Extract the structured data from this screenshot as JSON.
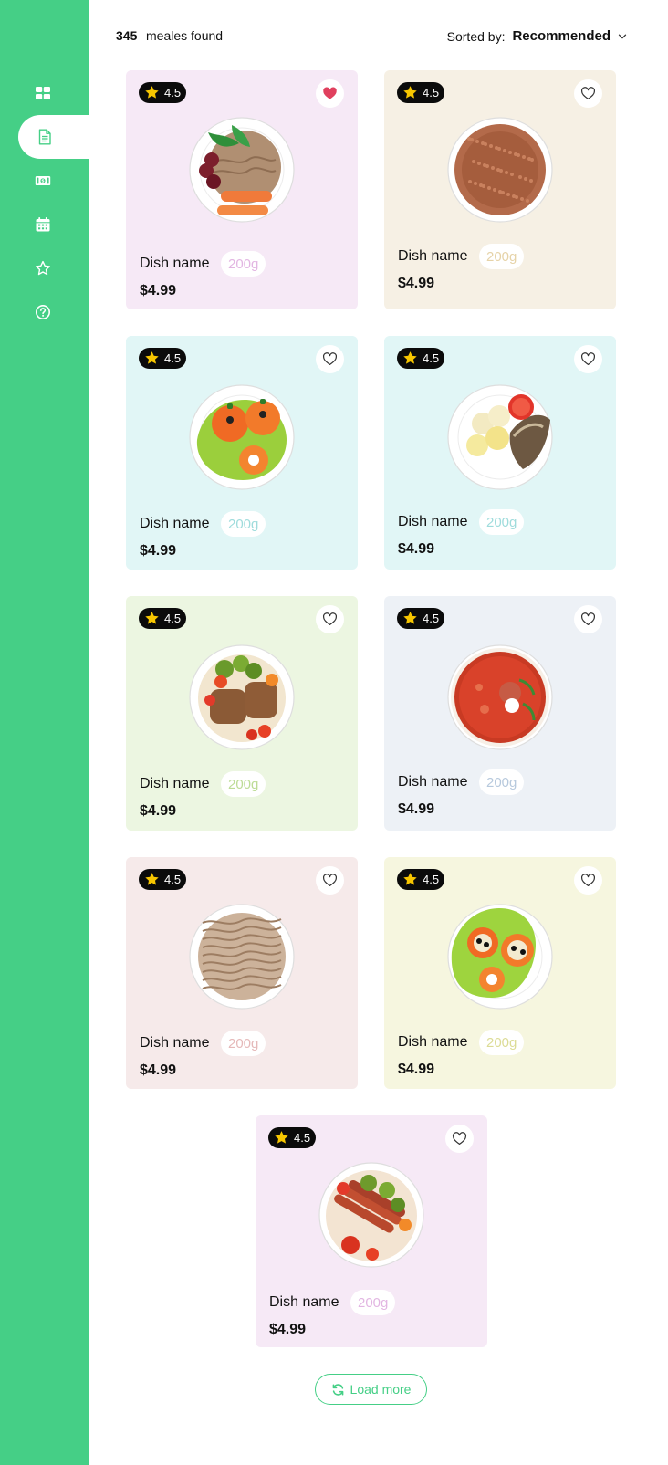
{
  "sidebar": {
    "items": [
      {
        "icon": "grid-icon",
        "active": false
      },
      {
        "icon": "document-icon",
        "active": true
      },
      {
        "icon": "money-icon",
        "active": false
      },
      {
        "icon": "calendar-icon",
        "active": false
      },
      {
        "icon": "star-icon",
        "active": false
      },
      {
        "icon": "help-icon",
        "active": false
      }
    ],
    "background": "#45cf86"
  },
  "results": {
    "count": "345",
    "count_label": "meales found",
    "sort_label": "Sorted by:",
    "sort_value": "Recommended"
  },
  "dishes": [
    {
      "rating": "4.5",
      "name": "Dish name",
      "weight": "200g",
      "price": "$4.99",
      "favorite": true,
      "bg": "#f6e9f6",
      "weight_color": "#e2b6e2",
      "plate": "noodles-carrots"
    },
    {
      "rating": "4.5",
      "name": "Dish name",
      "weight": "200g",
      "price": "$4.99",
      "favorite": false,
      "bg": "#f6f0e4",
      "weight_color": "#e6d3a8",
      "plate": "buckwheat"
    },
    {
      "rating": "4.5",
      "name": "Dish name",
      "weight": "200g",
      "price": "$4.99",
      "favorite": false,
      "bg": "#e1f6f6",
      "weight_color": "#9fdcdc",
      "plate": "stuffed-tomatoes"
    },
    {
      "rating": "4.5",
      "name": "Dish name",
      "weight": "200g",
      "price": "$4.99",
      "favorite": false,
      "bg": "#e1f6f6",
      "weight_color": "#9fdcdc",
      "plate": "fish-potatoes"
    },
    {
      "rating": "4.5",
      "name": "Dish name",
      "weight": "200g",
      "price": "$4.99",
      "favorite": false,
      "bg": "#ecf6e1",
      "weight_color": "#bddc96",
      "plate": "cutlets-veggies"
    },
    {
      "rating": "4.5",
      "name": "Dish name",
      "weight": "200g",
      "price": "$4.99",
      "favorite": false,
      "bg": "#edf1f6",
      "weight_color": "#b7c9dd",
      "plate": "borscht"
    },
    {
      "rating": "4.5",
      "name": "Dish name",
      "weight": "200g",
      "price": "$4.99",
      "favorite": false,
      "bg": "#f6eaea",
      "weight_color": "#e5b9b9",
      "plate": "noodles"
    },
    {
      "rating": "4.5",
      "name": "Dish name",
      "weight": "200g",
      "price": "$4.99",
      "favorite": false,
      "bg": "#f6f6df",
      "weight_color": "#dcdc96",
      "plate": "tomatoes-salad"
    },
    {
      "rating": "4.5",
      "name": "Dish name",
      "weight": "200g",
      "price": "$4.99",
      "favorite": false,
      "bg": "#f6e9f6",
      "weight_color": "#e2b6e2",
      "plate": "sausages-veggies"
    }
  ],
  "load_more": {
    "label": "Load more",
    "icon": "refresh-icon"
  },
  "colors": {
    "accent": "#45cf86",
    "favorite": "#e0405e",
    "rating_bg": "#0b0b0b",
    "star": "#f7c600"
  }
}
